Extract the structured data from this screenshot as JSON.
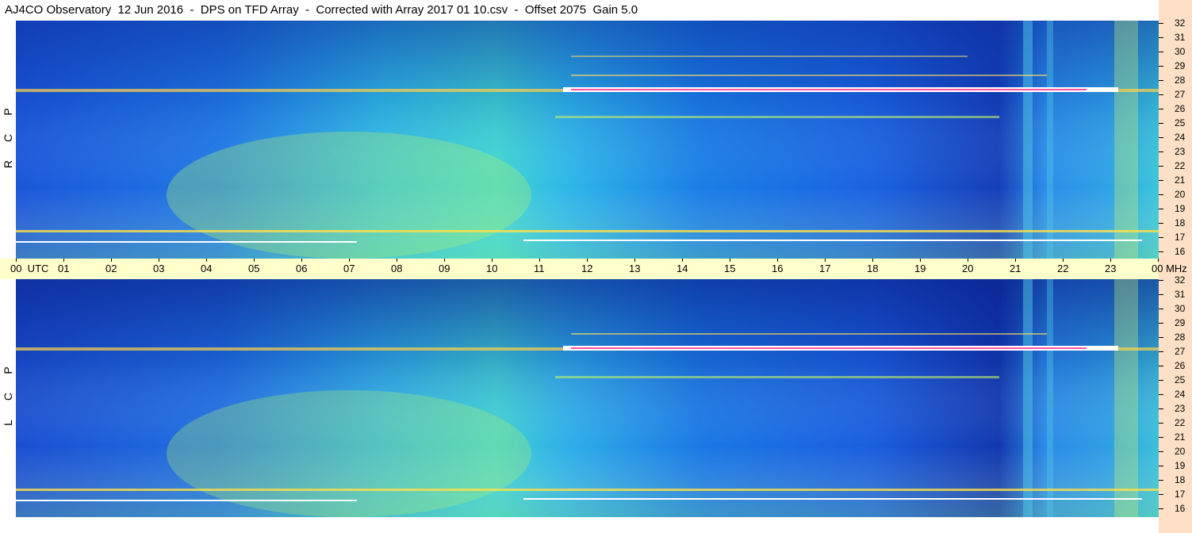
{
  "header": {
    "title": "AJ4CO Observatory  12 Jun 2016  -  DPS on TFD Array  -  Corrected with Array 2017 01 10.csv  -  Offset 2075  Gain 5.0"
  },
  "panels": [
    {
      "polarization_label": [
        "P",
        "C",
        "R"
      ]
    },
    {
      "polarization_label": [
        "P",
        "C",
        "L"
      ]
    }
  ],
  "time_axis": {
    "labels": [
      "00  UTC",
      "01",
      "02",
      "03",
      "04",
      "05",
      "06",
      "07",
      "08",
      "09",
      "10",
      "11",
      "12",
      "13",
      "14",
      "15",
      "16",
      "17",
      "18",
      "19",
      "20",
      "21",
      "22",
      "23",
      "00 MHz"
    ]
  },
  "freq_axis": {
    "labels": [
      "32",
      "31",
      "30",
      "29",
      "28",
      "27",
      "26",
      "25",
      "24",
      "23",
      "22",
      "21",
      "20",
      "19",
      "18",
      "17",
      "16"
    ]
  },
  "colors": {
    "background_right": "#fde0c5",
    "time_axis_bg": "#ffffcc",
    "spectrogram_base": "#1c5fe0",
    "hot_band": "#ffffff"
  }
}
